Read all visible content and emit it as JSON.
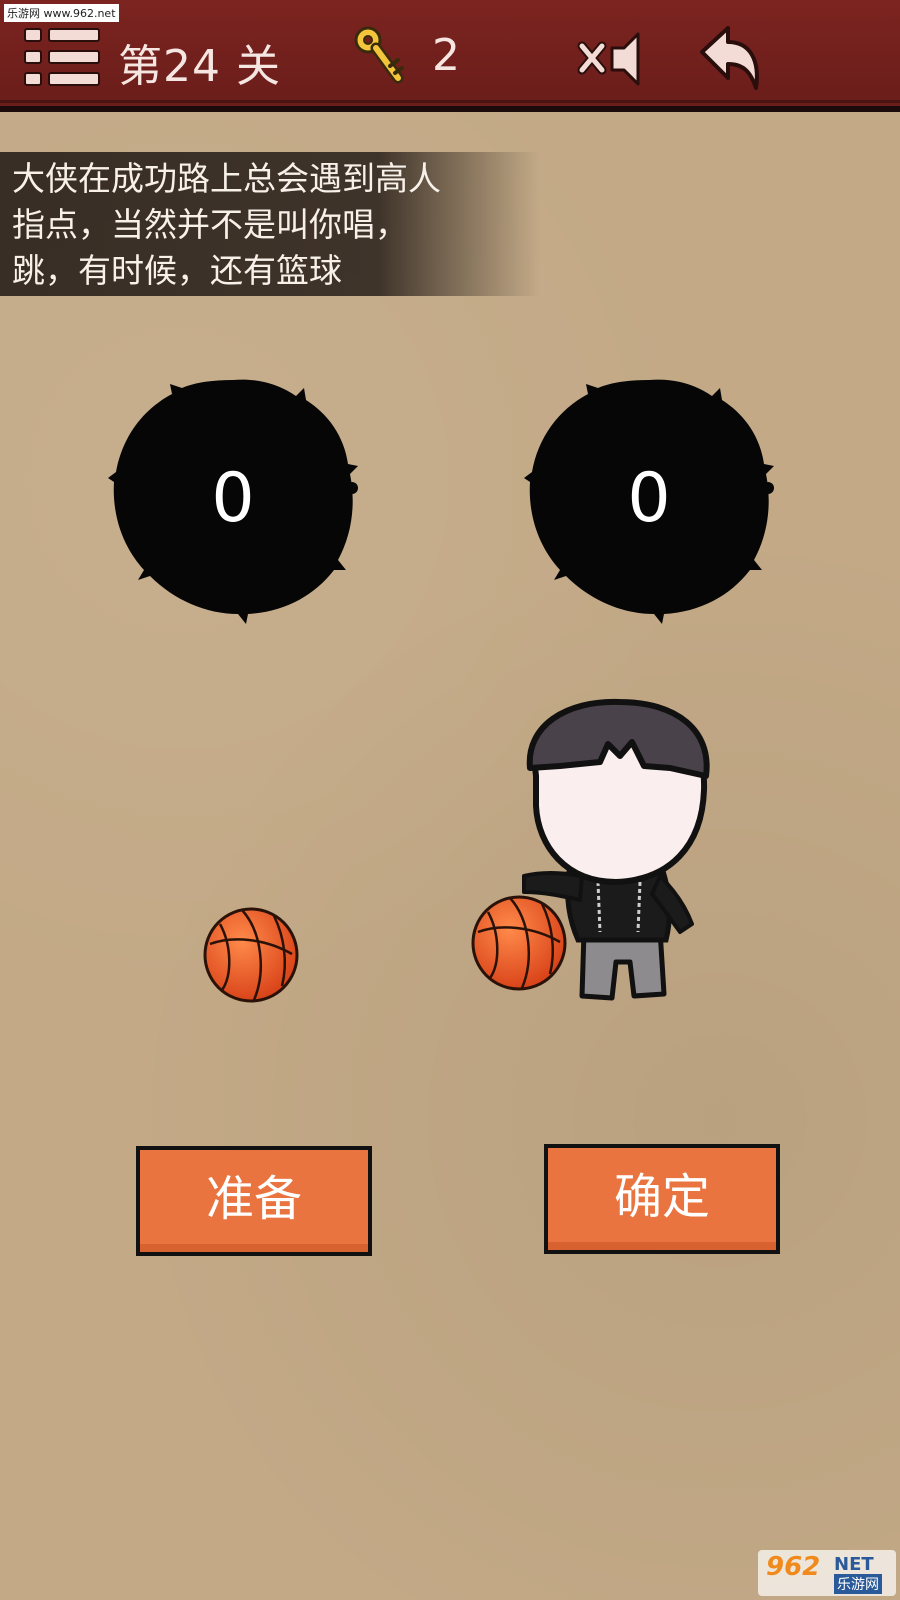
{
  "watermark_top": "乐游网 www.962.net",
  "header": {
    "level_label": "第24 关",
    "key_count": "2",
    "menu_icon": "list-menu-icon",
    "key_icon": "key-icon",
    "mute_icon": "speaker-muted-icon",
    "back_icon": "back-arrow-icon"
  },
  "hint": {
    "lines": [
      "大侠在成功路上总会遇到高人",
      "指点，当然并不是叫你唱，",
      "跳，有时候，还有篮球"
    ]
  },
  "scores": {
    "left": "0",
    "right": "0"
  },
  "buttons": {
    "ready": "准备",
    "confirm": "确定"
  },
  "watermark_bottom": {
    "num": "962",
    "net": "NET",
    "cn": "乐游网"
  },
  "colors": {
    "topbar": "#6f1f1c",
    "button": "#e97440",
    "paper": "#c3a986"
  }
}
